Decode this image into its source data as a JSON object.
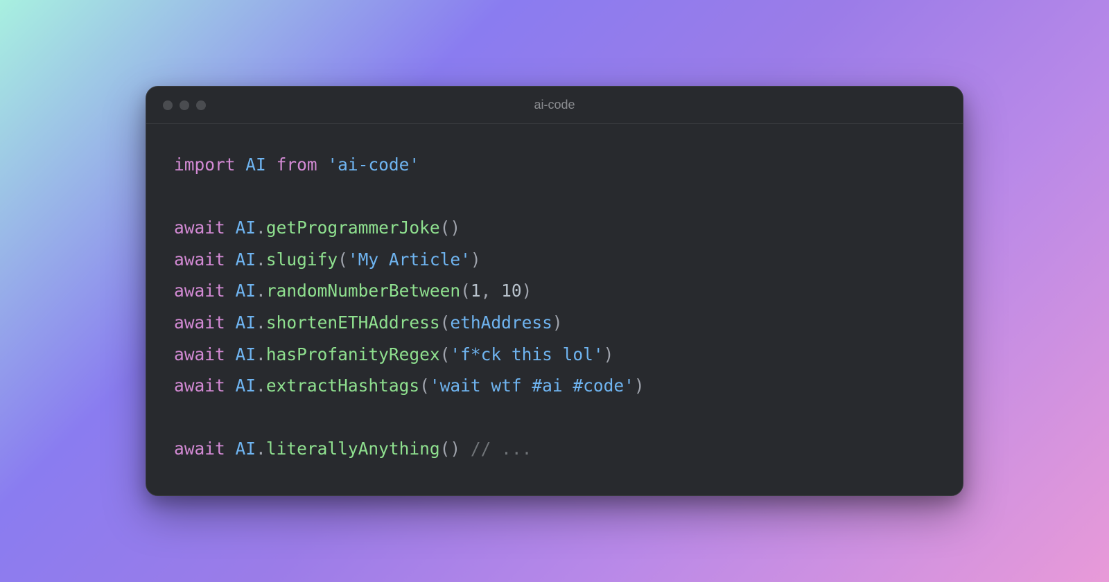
{
  "window": {
    "title": "ai-code"
  },
  "code": {
    "l1": {
      "kw1": "import",
      "id": "AI",
      "kw2": "from",
      "str": "'ai-code'"
    },
    "l3": {
      "kw": "await",
      "obj": "AI",
      "dot": ".",
      "fn": "getProgrammerJoke",
      "p1": "(",
      "p2": ")"
    },
    "l4": {
      "kw": "await",
      "obj": "AI",
      "dot": ".",
      "fn": "slugify",
      "p1": "(",
      "arg": "'My Article'",
      "p2": ")"
    },
    "l5": {
      "kw": "await",
      "obj": "AI",
      "dot": ".",
      "fn": "randomNumberBetween",
      "p1": "(",
      "a1": "1",
      "comma": ", ",
      "a2": "10",
      "p2": ")"
    },
    "l6": {
      "kw": "await",
      "obj": "AI",
      "dot": ".",
      "fn": "shortenETHAddress",
      "p1": "(",
      "arg": "ethAddress",
      "p2": ")"
    },
    "l7": {
      "kw": "await",
      "obj": "AI",
      "dot": ".",
      "fn": "hasProfanityRegex",
      "p1": "(",
      "arg": "'f*ck this lol'",
      "p2": ")"
    },
    "l8": {
      "kw": "await",
      "obj": "AI",
      "dot": ".",
      "fn": "extractHashtags",
      "p1": "(",
      "arg": "'wait wtf #ai #code'",
      "p2": ")"
    },
    "l10": {
      "kw": "await",
      "obj": "AI",
      "dot": ".",
      "fn": "literallyAnything",
      "p1": "(",
      "p2": ")",
      "cm": " // ..."
    }
  }
}
